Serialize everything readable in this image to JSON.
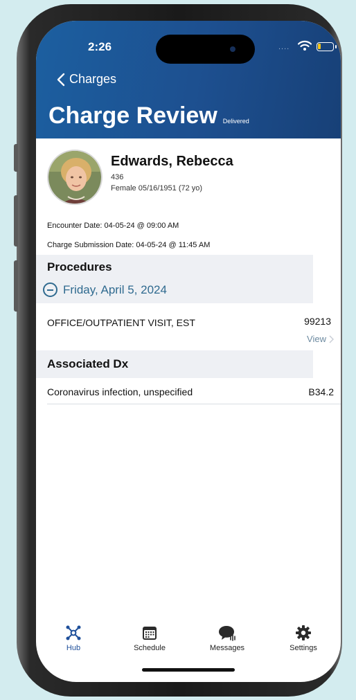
{
  "status_bar": {
    "time": "2:26",
    "signal": "....",
    "battery_color": "#f5c518"
  },
  "header": {
    "back_label": "Charges",
    "title": "Charge Review",
    "status_badge": "Delivered",
    "background_color": "#1d4f8f"
  },
  "patient": {
    "name": "Edwards, Rebecca",
    "id": "436",
    "demographics": "Female 05/16/1951 (72 yo)"
  },
  "encounter": {
    "encounter_date": "Encounter Date: 04-05-24 @ 09:00 AM",
    "submission_date": "Charge Submission Date:  04-05-24 @ 11:45 AM"
  },
  "procedures": {
    "section_label": "Procedures",
    "date_label": "Friday, April 5, 2024",
    "items": [
      {
        "name": "OFFICE/OUTPATIENT VISIT, EST",
        "code": "99213",
        "action": "View"
      }
    ]
  },
  "diagnoses": {
    "section_label": "Associated Dx",
    "items": [
      {
        "name": "Coronavirus infection, unspecified",
        "code": "B34.2"
      }
    ]
  },
  "tabbar": {
    "active": "Hub",
    "active_color": "#1e4f9a",
    "tabs": [
      {
        "label": "Hub",
        "icon": "hub-icon"
      },
      {
        "label": "Schedule",
        "icon": "calendar-icon"
      },
      {
        "label": "Messages",
        "icon": "chat-bubble-icon"
      },
      {
        "label": "Settings",
        "icon": "gear-icon"
      }
    ]
  }
}
